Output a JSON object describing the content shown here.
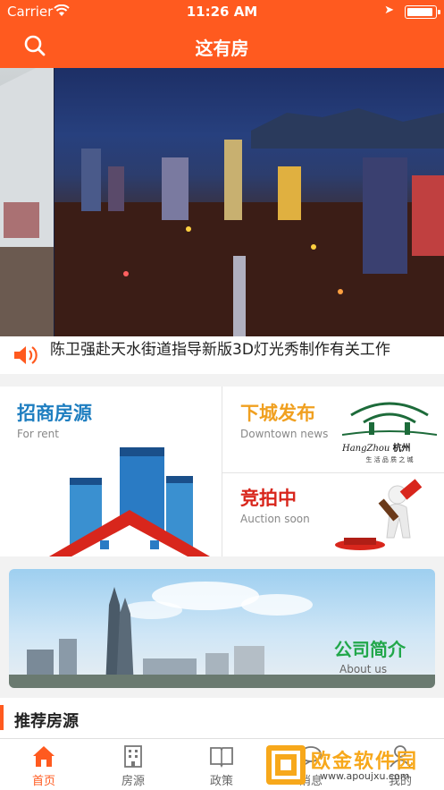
{
  "status": {
    "carrier": "Carrier",
    "time": "11:26 AM",
    "battery_level": 0.9
  },
  "nav": {
    "title": "这有房"
  },
  "banner": {
    "slide_count": 3,
    "active_slide": 1
  },
  "news": {
    "headline": "陈卫强赴天水街道指导新版3D灯光秀制作有关工作"
  },
  "cards": {
    "rent": {
      "title": "招商房源",
      "subtitle": "For rent",
      "color": "#1e7ec0"
    },
    "downtown": {
      "title": "下城发布",
      "subtitle": "Downtown news",
      "color": "#f0a020",
      "logo_cn": "杭州",
      "logo_en": "HangZhou",
      "logo_slogan": "生 活 品 质 之 城"
    },
    "auction": {
      "title": "竞拍中",
      "subtitle": "Auction soon",
      "color": "#d8261c"
    }
  },
  "company": {
    "title": "公司简介",
    "subtitle": "About us"
  },
  "recommend": {
    "title": "推荐房源"
  },
  "tabs": [
    {
      "label": "首页",
      "icon": "home-icon",
      "active": true
    },
    {
      "label": "房源",
      "icon": "building-icon",
      "active": false
    },
    {
      "label": "政策",
      "icon": "book-icon",
      "active": false
    },
    {
      "label": "消息",
      "icon": "message-icon",
      "active": false
    },
    {
      "label": "我的",
      "icon": "user-icon",
      "active": false
    }
  ],
  "watermark": {
    "title": "欧金软件园",
    "url": "www.apoujxu.com"
  }
}
